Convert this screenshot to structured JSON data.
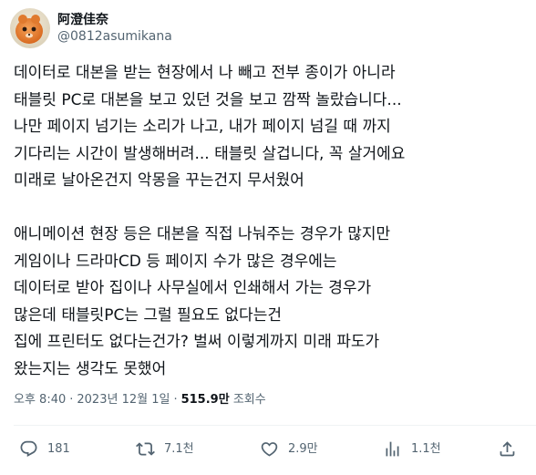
{
  "author": {
    "display_name": "阿澄佳奈",
    "handle": "@0812asumikana"
  },
  "tweet": {
    "lines": [
      "데이터로 대본을 받는 현장에서 나 빼고 전부 종이가 아니라",
      "태블릿 PC로 대본을 보고 있던 것을 보고 깜짝 놀랐습니다...",
      "나만 페이지 넘기는 소리가 나고, 내가 페이지 넘길 때 까지",
      "기다리는 시간이 발생해버려... 태블릿 살겁니다, 꼭 살거에요",
      "미래로 날아온건지 악몽을 꾸는건지 무서웠어",
      "",
      "애니메이션 현장 등은 대본을 직접 나눠주는 경우가 많지만",
      "게임이나 드라마CD 등 페이지 수가 많은 경우에는",
      "데이터로 받아 집이나 사무실에서 인쇄해서 가는 경우가",
      "많은데 태블릿PC는 그럴 필요도 없다는건",
      "집에 프린터도 없다는건가? 벌써 이렇게까지 미래 파도가",
      "왔는지는 생각도 못했어"
    ]
  },
  "meta": {
    "time": "오후 8:40",
    "separator": "·",
    "date": "2023년 12월 1일",
    "views_count": "515.9만",
    "views_label": "조회수"
  },
  "actions": {
    "reply_count": "181",
    "repost_count": "7.1천",
    "like_count": "2.9만",
    "views_count": "1.1천"
  },
  "colors": {
    "text_primary": "#0f1419",
    "text_secondary": "#536471",
    "divider": "#eff3f4"
  },
  "icons": {
    "reply": "speech-bubble-icon",
    "repost": "repost-arrows-icon",
    "like": "heart-icon",
    "views": "bar-chart-icon",
    "share": "share-upload-icon"
  }
}
